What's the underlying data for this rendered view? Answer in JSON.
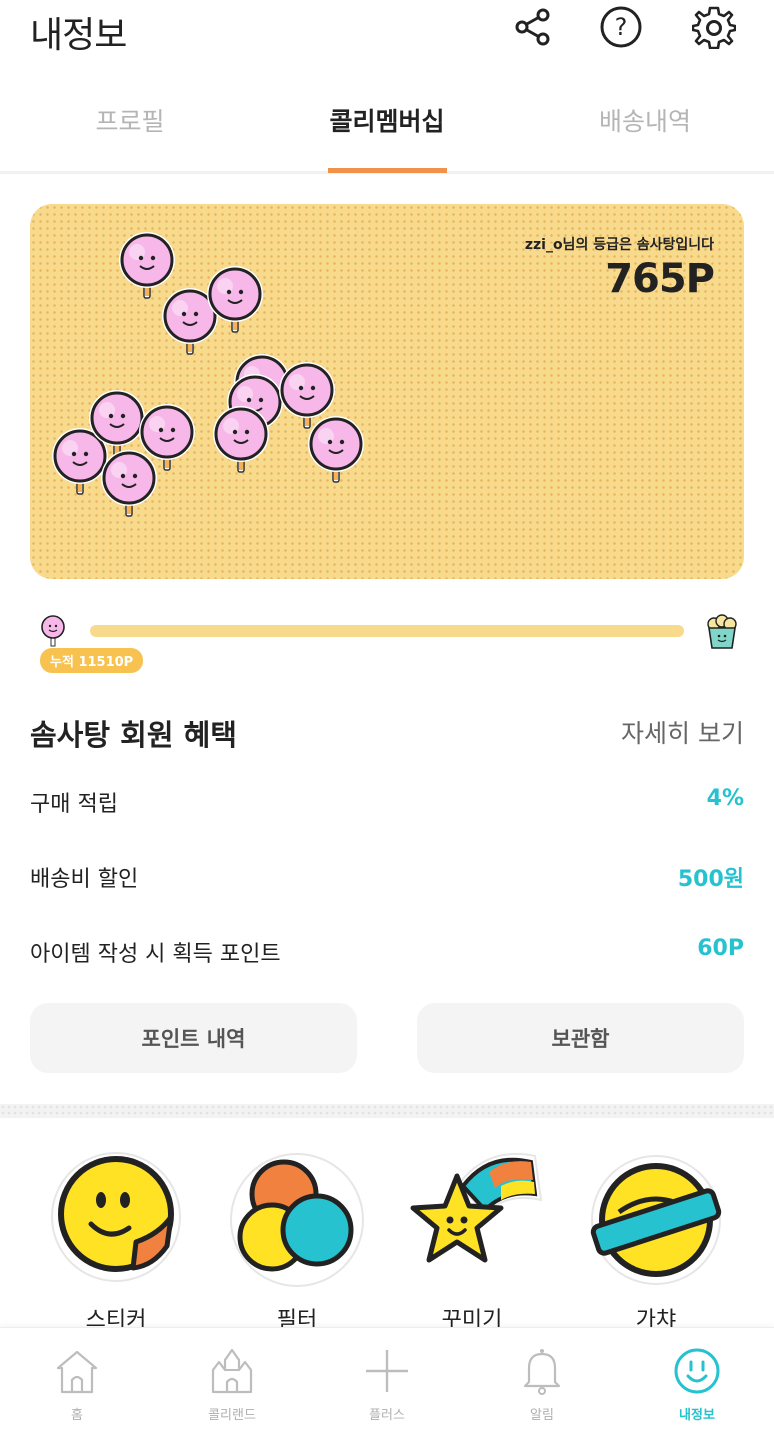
{
  "header": {
    "title": "내정보",
    "icons": [
      "share-icon",
      "help-icon",
      "settings-icon"
    ]
  },
  "tabs": [
    {
      "label": "프로필",
      "active": false
    },
    {
      "label": "콜리멤버십",
      "active": true
    },
    {
      "label": "배송내역",
      "active": false
    }
  ],
  "membership": {
    "grade_text": "zzi_o님의 등급은 솜사탕입니다",
    "points": "765P",
    "accumulated": "누적 11510P"
  },
  "benefits": {
    "title": "솜사탕 회원 혜택",
    "detail_link": "자세히 보기",
    "rows": [
      {
        "label": "구매 적립",
        "value": "4%"
      },
      {
        "label": "배송비 할인",
        "value": "500원"
      },
      {
        "label": "아이템 작성 시 획득 포인트",
        "value": "60P"
      }
    ]
  },
  "buttons": {
    "points_history": "포인트 내역",
    "storage": "보관함"
  },
  "menu": [
    {
      "label": "스티커",
      "icon": "smiley-sticker-icon"
    },
    {
      "label": "필터",
      "icon": "filter-circles-icon"
    },
    {
      "label": "꾸미기",
      "icon": "star-rainbow-icon"
    },
    {
      "label": "가챠",
      "icon": "gacha-capsule-icon"
    }
  ],
  "bottom_nav": [
    {
      "label": "홈",
      "icon": "home-icon",
      "active": false
    },
    {
      "label": "콜리랜드",
      "icon": "castle-icon",
      "active": false
    },
    {
      "label": "플러스",
      "icon": "plus-icon",
      "active": false
    },
    {
      "label": "알림",
      "icon": "bell-icon",
      "active": false
    },
    {
      "label": "내정보",
      "icon": "smiley-face-icon",
      "active": true
    }
  ],
  "colors": {
    "accent_orange": "#f0924a",
    "accent_teal": "#26c2cf",
    "card_yellow": "#f8da8c",
    "badge_yellow": "#f7c24f"
  }
}
